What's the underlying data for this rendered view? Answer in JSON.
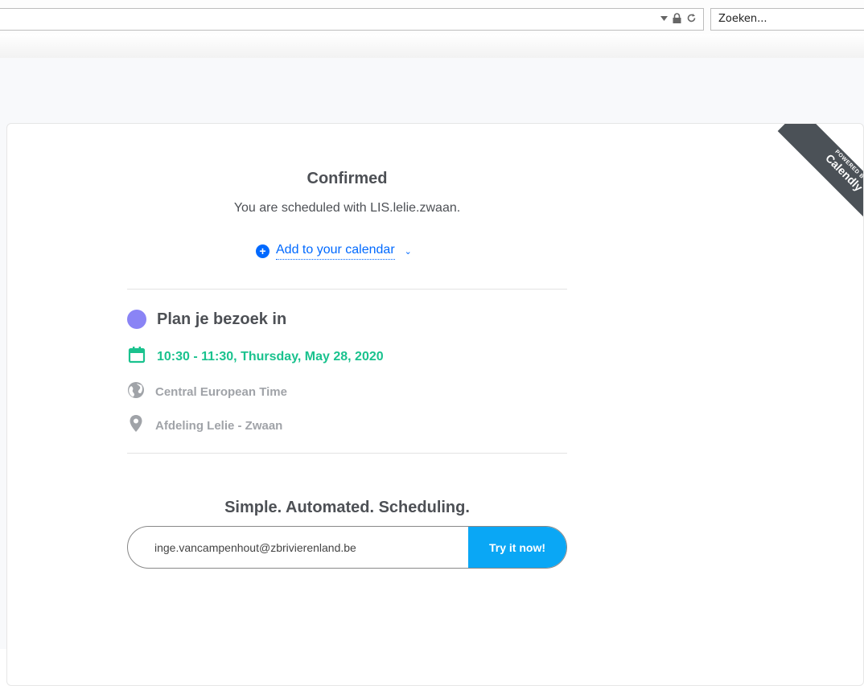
{
  "browser": {
    "search_placeholder": "Zoeken..."
  },
  "ribbon": {
    "top_text": "POWERED BY",
    "brand": "Calendly"
  },
  "confirmation": {
    "title": "Confirmed",
    "subtitle": "You are scheduled with LIS.lelie.zwaan.",
    "add_calendar_label": "Add to your calendar"
  },
  "event": {
    "name": "Plan je bezoek in",
    "color": "#8a84f5",
    "time": "10:30 - 11:30, Thursday, May 28, 2020",
    "timezone": "Central European Time",
    "location": "Afdeling Lelie - Zwaan"
  },
  "promo": {
    "slogan": "Simple. Automated. Scheduling.",
    "email_value": "inge.vancampenhout@zbrivierenland.be",
    "button_label": "Try it now!"
  },
  "colors": {
    "accent_blue": "#0069ff",
    "time_green": "#1ac28e",
    "button_blue": "#0aa7f5"
  }
}
